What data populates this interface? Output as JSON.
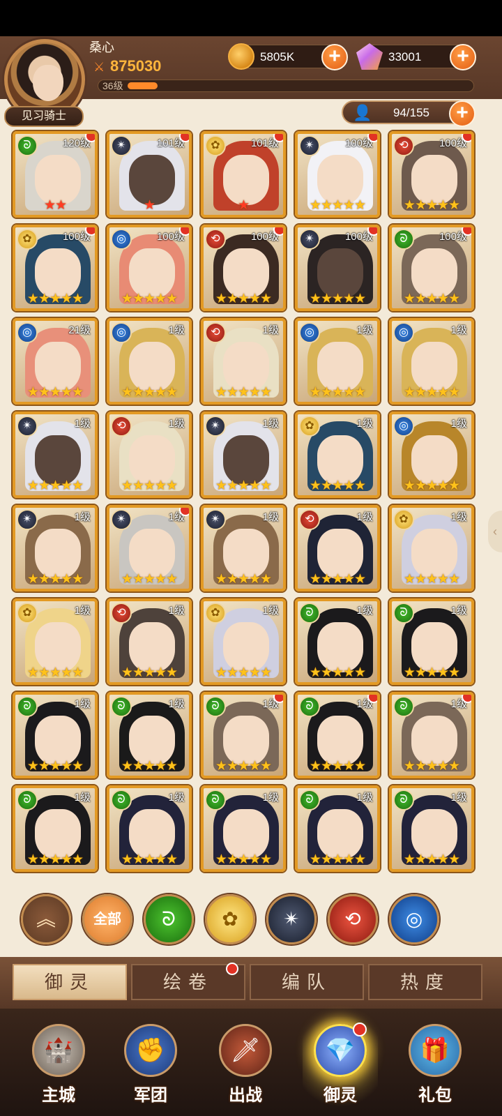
{
  "player": {
    "name": "桑心",
    "title": "见习骑士",
    "power": "875030",
    "level_text": "36级",
    "level_progress": 0.09
  },
  "currency": {
    "gold": "5805K",
    "gems": "33001"
  },
  "hero_count": "94/155",
  "heroes": [
    {
      "faction": "green",
      "level": "120级",
      "stars": 2,
      "star_color": "red",
      "dot": true,
      "tone": "#d9d5cc"
    },
    {
      "faction": "dark",
      "level": "101级",
      "stars": 1,
      "star_color": "red",
      "dot": true,
      "tone": "#e3e3ea"
    },
    {
      "faction": "gold",
      "level": "101级",
      "stars": 1,
      "star_color": "red",
      "dot": true,
      "tone": "#c0412a"
    },
    {
      "faction": "dark",
      "level": "100级",
      "stars": 5,
      "star_color": "gold",
      "dot": true,
      "tone": "#f2f2f6"
    },
    {
      "faction": "red",
      "level": "100级",
      "stars": 5,
      "star_color": "gold",
      "dot": true,
      "tone": "#6e5a4d"
    },
    {
      "faction": "gold",
      "level": "100级",
      "stars": 5,
      "star_color": "gold",
      "dot": true,
      "tone": "#274a66"
    },
    {
      "faction": "blue",
      "level": "100级",
      "stars": 5,
      "star_color": "gold",
      "dot": true,
      "tone": "#e88b74"
    },
    {
      "faction": "red",
      "level": "100级",
      "stars": 5,
      "star_color": "gold",
      "dot": true,
      "tone": "#3b2a22"
    },
    {
      "faction": "dark",
      "level": "100级",
      "stars": 5,
      "star_color": "gold",
      "dot": true,
      "tone": "#2b2423"
    },
    {
      "faction": "green",
      "level": "100级",
      "stars": 5,
      "star_color": "gold",
      "dot": true,
      "tone": "#7b6858"
    },
    {
      "faction": "blue",
      "level": "21级",
      "stars": 5,
      "star_color": "gold",
      "dot": false,
      "tone": "#e8907a"
    },
    {
      "faction": "blue",
      "level": "1级",
      "stars": 5,
      "star_color": "gold",
      "dot": false,
      "tone": "#d9b458"
    },
    {
      "faction": "red",
      "level": "1级",
      "stars": 5,
      "star_color": "gold",
      "dot": false,
      "tone": "#e9e0c4"
    },
    {
      "faction": "blue",
      "level": "1级",
      "stars": 5,
      "star_color": "gold",
      "dot": false,
      "tone": "#d9b458"
    },
    {
      "faction": "blue",
      "level": "1级",
      "stars": 5,
      "star_color": "gold",
      "dot": false,
      "tone": "#d9b458"
    },
    {
      "faction": "dark",
      "level": "1级",
      "stars": 5,
      "star_color": "gold",
      "dot": false,
      "tone": "#e3e3ea"
    },
    {
      "faction": "red",
      "level": "1级",
      "stars": 5,
      "star_color": "gold",
      "dot": false,
      "tone": "#e9e0c4"
    },
    {
      "faction": "dark",
      "level": "1级",
      "stars": 5,
      "star_color": "gold",
      "dot": false,
      "tone": "#e3e3ea"
    },
    {
      "faction": "gold",
      "level": "1级",
      "stars": 5,
      "star_color": "gold",
      "dot": false,
      "tone": "#274a66"
    },
    {
      "faction": "blue",
      "level": "1级",
      "stars": 5,
      "star_color": "gold",
      "dot": false,
      "tone": "#b8862a"
    },
    {
      "faction": "dark",
      "level": "1级",
      "stars": 5,
      "star_color": "gold",
      "dot": false,
      "tone": "#8a6a4a"
    },
    {
      "faction": "dark",
      "level": "1级",
      "stars": 5,
      "star_color": "gold",
      "dot": true,
      "tone": "#c9c6c1"
    },
    {
      "faction": "dark",
      "level": "1级",
      "stars": 5,
      "star_color": "gold",
      "dot": false,
      "tone": "#8a6a4a"
    },
    {
      "faction": "red",
      "level": "1级",
      "stars": 5,
      "star_color": "gold",
      "dot": false,
      "tone": "#1f2436"
    },
    {
      "faction": "gold",
      "level": "1级",
      "stars": 5,
      "star_color": "gold",
      "dot": false,
      "tone": "#cfcfe0"
    },
    {
      "faction": "gold",
      "level": "1级",
      "stars": 5,
      "star_color": "gold",
      "dot": false,
      "tone": "#efd48a"
    },
    {
      "faction": "red",
      "level": "1级",
      "stars": 5,
      "star_color": "gold",
      "dot": false,
      "tone": "#4e423b"
    },
    {
      "faction": "gold",
      "level": "1级",
      "stars": 5,
      "star_color": "gold",
      "dot": false,
      "tone": "#cfcfe0"
    },
    {
      "faction": "green",
      "level": "1级",
      "stars": 5,
      "star_color": "gold",
      "dot": false,
      "tone": "#1b1a1c"
    },
    {
      "faction": "green",
      "level": "1级",
      "stars": 5,
      "star_color": "gold",
      "dot": false,
      "tone": "#1b1a1c"
    },
    {
      "faction": "green",
      "level": "1级",
      "stars": 5,
      "star_color": "gold",
      "dot": false,
      "tone": "#1b1a1c"
    },
    {
      "faction": "green",
      "level": "1级",
      "stars": 5,
      "star_color": "gold",
      "dot": false,
      "tone": "#1a1a1a"
    },
    {
      "faction": "green",
      "level": "1级",
      "stars": 5,
      "star_color": "gold",
      "dot": true,
      "tone": "#7b6858"
    },
    {
      "faction": "green",
      "level": "1级",
      "stars": 5,
      "star_color": "gold",
      "dot": true,
      "tone": "#1b1a1c"
    },
    {
      "faction": "green",
      "level": "1级",
      "stars": 5,
      "star_color": "gold",
      "dot": true,
      "tone": "#7b6858"
    },
    {
      "faction": "green",
      "level": "1级",
      "stars": 5,
      "star_color": "gold",
      "dot": false,
      "tone": "#1b1a1c"
    },
    {
      "faction": "green",
      "level": "1级",
      "stars": 5,
      "star_color": "gold",
      "dot": false,
      "tone": "#22233a"
    },
    {
      "faction": "green",
      "level": "1级",
      "stars": 5,
      "star_color": "gold",
      "dot": false,
      "tone": "#22233a"
    },
    {
      "faction": "green",
      "level": "1级",
      "stars": 5,
      "star_color": "gold",
      "dot": false,
      "tone": "#22233a"
    },
    {
      "faction": "green",
      "level": "1级",
      "stars": 5,
      "star_color": "gold",
      "dot": false,
      "tone": "#22233a"
    }
  ],
  "filters": {
    "all_label": "全部",
    "icons": [
      "collapse-icon",
      "all-filter",
      "wind-faction-icon",
      "rose-faction-icon",
      "dark-faction-icon",
      "fire-faction-icon",
      "water-faction-icon"
    ]
  },
  "tabs": [
    {
      "label": "御灵",
      "active": true,
      "dot": false
    },
    {
      "label": "绘卷",
      "active": false,
      "dot": true
    },
    {
      "label": "编队",
      "active": false,
      "dot": false
    },
    {
      "label": "热度",
      "active": false,
      "dot": false
    }
  ],
  "nav": [
    {
      "label": "主城",
      "icon": "castle-icon",
      "active": false,
      "dot": false
    },
    {
      "label": "军团",
      "icon": "fist-shield-icon",
      "active": false,
      "dot": false
    },
    {
      "label": "出战",
      "icon": "sword-gate-icon",
      "active": false,
      "dot": false
    },
    {
      "label": "御灵",
      "icon": "crystal-icon",
      "active": true,
      "dot": true
    },
    {
      "label": "礼包",
      "icon": "shop-icon",
      "active": false,
      "dot": false
    }
  ]
}
